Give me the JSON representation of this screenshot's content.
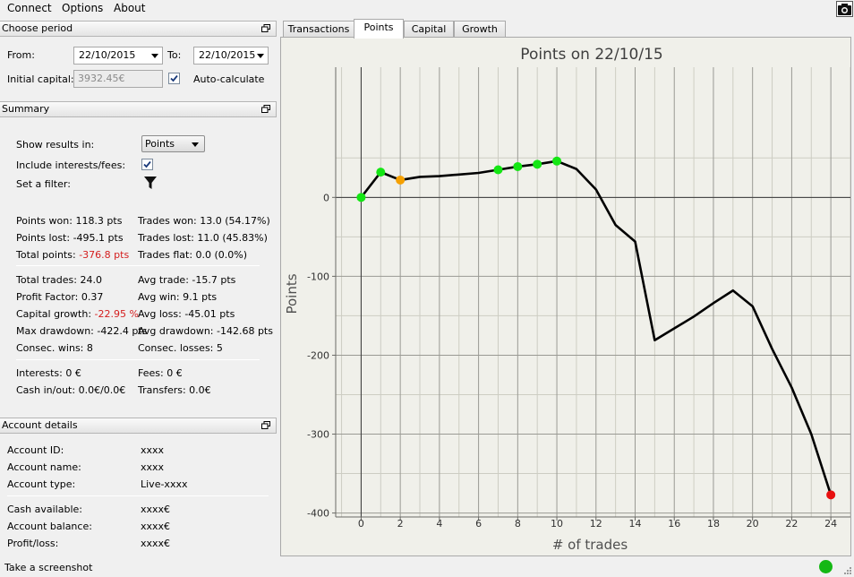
{
  "menu": [
    "Connect",
    "Options",
    "About"
  ],
  "icons": {
    "camera": "camera-icon",
    "restore": "window-restore-icon",
    "filter": "filter-icon"
  },
  "period": {
    "header": "Choose period",
    "from_label": "From:",
    "from_value": "22/10/2015",
    "to_label": "To:",
    "to_value": "22/10/2015",
    "capital_label": "Initial capital:",
    "capital_value": "3932.45€",
    "auto_calc_label": "Auto-calculate",
    "auto_calc_checked": true
  },
  "summary": {
    "header": "Summary",
    "show_results_label": "Show results in:",
    "show_results_value": "Points",
    "include_fees_label": "Include interests/fees:",
    "include_fees_checked": true,
    "filter_label": "Set a filter:",
    "stats": {
      "points_won": "Points won: 118.3 pts",
      "points_lost": "Points lost: -495.1 pts",
      "total_points_label": "Total points:",
      "total_points_value": "-376.8 pts",
      "trades_won": "Trades won: 13.0 (54.17%)",
      "trades_lost": "Trades lost: 11.0 (45.83%)",
      "trades_flat": "Trades flat: 0.0 (0.0%)",
      "total_trades": "Total trades: 24.0",
      "profit_factor": "Profit Factor: 0.37",
      "capital_growth_label": "Capital growth:",
      "capital_growth_value": "-22.95 %",
      "max_drawdown": "Max drawdown: -422.4 pts",
      "consec_wins": "Consec. wins: 8",
      "avg_trade": "Avg trade: -15.7 pts",
      "avg_win": "Avg win: 9.1 pts",
      "avg_loss": "Avg loss: -45.01 pts",
      "avg_drawdown": "Avg drawdown: -142.68 pts",
      "consec_losses": "Consec. losses: 5",
      "interests": "Interests: 0 €",
      "cash_in_out": "Cash in/out: 0.0€/0.0€",
      "fees": "Fees: 0 €",
      "transfers": "Transfers: 0.0€"
    }
  },
  "account": {
    "header": "Account details",
    "rows": [
      {
        "label": "Account ID:",
        "value": "xxxx"
      },
      {
        "label": "Account name:",
        "value": "xxxx"
      },
      {
        "label": "Account type:",
        "value": "Live-xxxx"
      },
      {
        "label": "Cash available:",
        "value": "xxxx€"
      },
      {
        "label": "Account balance:",
        "value": "xxxx€"
      },
      {
        "label": "Profit/loss:",
        "value": "xxxx€"
      }
    ]
  },
  "tabs": [
    "Transactions",
    "Points",
    "Capital",
    "Growth"
  ],
  "active_tab": "Points",
  "status": {
    "text": "Take a screenshot",
    "connection_color": "#14b814"
  },
  "colors": {
    "positive": "#14e614",
    "neutral": "#f5a000",
    "negative": "#e81010",
    "negative_text": "#d41e1e"
  },
  "chart_data": {
    "type": "line",
    "title": "Points on 22/10/15",
    "xlabel": "# of trades",
    "ylabel": "Points",
    "xlim": [
      -1.3,
      25
    ],
    "ylim": [
      -405,
      165
    ],
    "xticks": [
      0,
      2,
      4,
      6,
      8,
      10,
      12,
      14,
      16,
      18,
      20,
      22,
      24
    ],
    "yticks": [
      0,
      -100,
      -200,
      -300,
      -400
    ],
    "grid": true,
    "series": [
      {
        "x": [
          0,
          1,
          2,
          3,
          4,
          5,
          6,
          7,
          8,
          9,
          10,
          11,
          12,
          13,
          14,
          15,
          16,
          17,
          18,
          19,
          20,
          21,
          22,
          23,
          24
        ],
        "values": [
          0,
          32,
          22,
          26,
          27,
          29,
          31,
          35,
          39,
          42,
          46,
          36,
          10,
          -35,
          -56,
          -181,
          -166,
          -151,
          -134,
          -118,
          -138,
          -192,
          -241,
          -300,
          -377
        ]
      }
    ],
    "markers": [
      {
        "x": 0,
        "y": 0,
        "kind": "positive"
      },
      {
        "x": 1,
        "y": 32,
        "kind": "positive"
      },
      {
        "x": 2,
        "y": 22,
        "kind": "neutral"
      },
      {
        "x": 7,
        "y": 35,
        "kind": "positive"
      },
      {
        "x": 8,
        "y": 39,
        "kind": "positive"
      },
      {
        "x": 9,
        "y": 42,
        "kind": "positive"
      },
      {
        "x": 10,
        "y": 46,
        "kind": "positive"
      },
      {
        "x": 24,
        "y": -377,
        "kind": "negative"
      }
    ]
  }
}
